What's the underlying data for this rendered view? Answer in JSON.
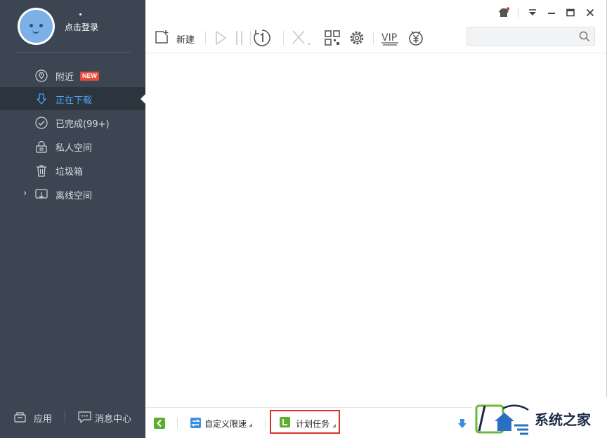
{
  "user": {
    "login_label": "点击登录"
  },
  "sidebar": {
    "items": [
      {
        "label": "附近",
        "icon": "location-pin-icon",
        "badge": "NEW"
      },
      {
        "label": "正在下载",
        "icon": "download-arrow-icon",
        "active": true
      },
      {
        "label": "已完成(99+)",
        "icon": "check-circle-icon"
      },
      {
        "label": "私人空间",
        "icon": "lock-icon"
      },
      {
        "label": "垃圾箱",
        "icon": "trash-icon"
      },
      {
        "label": "离线空间",
        "icon": "cloud-download-icon",
        "expandable": true
      }
    ],
    "bottom": {
      "apps_label": "应用",
      "messages_label": "消息中心"
    }
  },
  "toolbar": {
    "new_label": "新建",
    "buttons": [
      "new-task-icon",
      "play-icon",
      "pause-icon",
      "one-icon",
      "delete-icon",
      "qr-code-icon",
      "settings-gear-icon",
      "vip-icon",
      "yuan-piggy-icon"
    ]
  },
  "window_controls": [
    "skin-shirt-icon",
    "menu-dropdown-icon",
    "minimize-icon",
    "maximize-icon",
    "close-icon"
  ],
  "search": {
    "placeholder": ""
  },
  "statusbar": {
    "speed_label": "自定义限速",
    "plan_label": "计划任务"
  },
  "watermark": {
    "text": "系统之家"
  },
  "colors": {
    "sidebar_bg": "#3c4653",
    "active_bg": "#2c343e",
    "active_text": "#4ea4f6",
    "badge": "#e64b3b",
    "highlight_border": "#d9342b",
    "green": "#5cae2e",
    "blue": "#3d8ee0"
  }
}
